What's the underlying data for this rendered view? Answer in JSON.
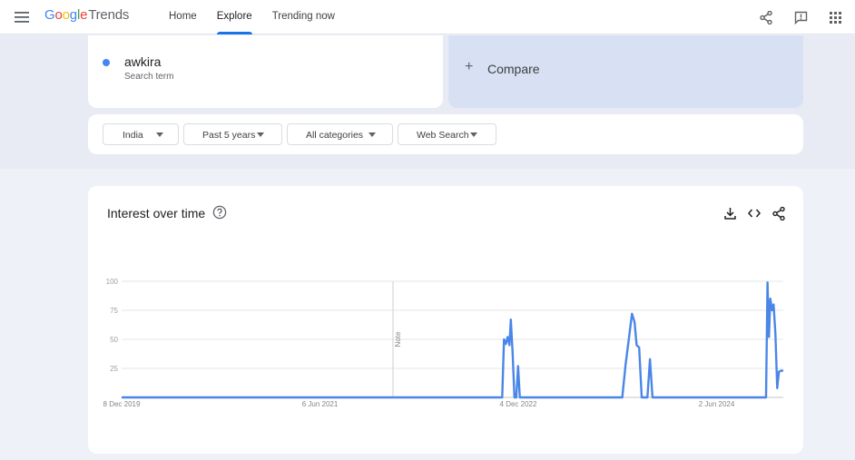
{
  "header": {
    "logo_google": "Google",
    "logo_product": "Trends",
    "nav": [
      {
        "label": "Home",
        "active": false
      },
      {
        "label": "Explore",
        "active": true
      },
      {
        "label": "Trending now",
        "active": false
      }
    ],
    "icons": [
      "menu-icon",
      "share-icon",
      "feedback-icon",
      "apps-grid-icon"
    ]
  },
  "search_term": {
    "name": "awkira",
    "sublabel": "Search term",
    "color": "#4285f4"
  },
  "compare": {
    "label": "Compare"
  },
  "filters": [
    {
      "label": "India"
    },
    {
      "label": "Past 5 years"
    },
    {
      "label": "All categories"
    },
    {
      "label": "Web Search"
    }
  ],
  "chart_section": {
    "title": "Interest over time",
    "actions": [
      "download-icon",
      "embed-icon",
      "share-icon"
    ],
    "note_label": "Note"
  },
  "chart_data": {
    "type": "line",
    "ylim": [
      0,
      100
    ],
    "y_ticks": [
      25,
      50,
      75,
      100
    ],
    "x_tick_labels": [
      "8 Dec 2019",
      "6 Jun 2021",
      "4 Dec 2022",
      "2 Jun 2024"
    ],
    "xlim": [
      "2019-12-08",
      "2024-12-22"
    ],
    "note_date": "2022-01-01",
    "grid": true,
    "series": [
      {
        "color": "#4a86e8",
        "points": [
          [
            "2019-12-08",
            0
          ],
          [
            "2022-11-01",
            0
          ],
          [
            "2022-11-06",
            50
          ],
          [
            "2022-11-11",
            46
          ],
          [
            "2022-11-16",
            52
          ],
          [
            "2022-11-21",
            45
          ],
          [
            "2022-11-25",
            67
          ],
          [
            "2022-11-30",
            38
          ],
          [
            "2022-12-05",
            0
          ],
          [
            "2022-12-10",
            0
          ],
          [
            "2022-12-15",
            27
          ],
          [
            "2022-12-20",
            0
          ],
          [
            "2023-10-01",
            0
          ],
          [
            "2023-10-10",
            28
          ],
          [
            "2023-10-20",
            52
          ],
          [
            "2023-10-28",
            72
          ],
          [
            "2023-11-04",
            65
          ],
          [
            "2023-11-10",
            45
          ],
          [
            "2023-11-17",
            43
          ],
          [
            "2023-11-24",
            0
          ],
          [
            "2023-12-10",
            0
          ],
          [
            "2023-12-17",
            33
          ],
          [
            "2023-12-24",
            0
          ],
          [
            "2024-11-04",
            0
          ],
          [
            "2024-11-08",
            99
          ],
          [
            "2024-11-12",
            52
          ],
          [
            "2024-11-16",
            85
          ],
          [
            "2024-11-21",
            75
          ],
          [
            "2024-11-25",
            80
          ],
          [
            "2024-11-30",
            55
          ],
          [
            "2024-12-05",
            8
          ],
          [
            "2024-12-10",
            22
          ],
          [
            "2024-12-15",
            23
          ],
          [
            "2024-12-22",
            23
          ]
        ]
      }
    ]
  }
}
